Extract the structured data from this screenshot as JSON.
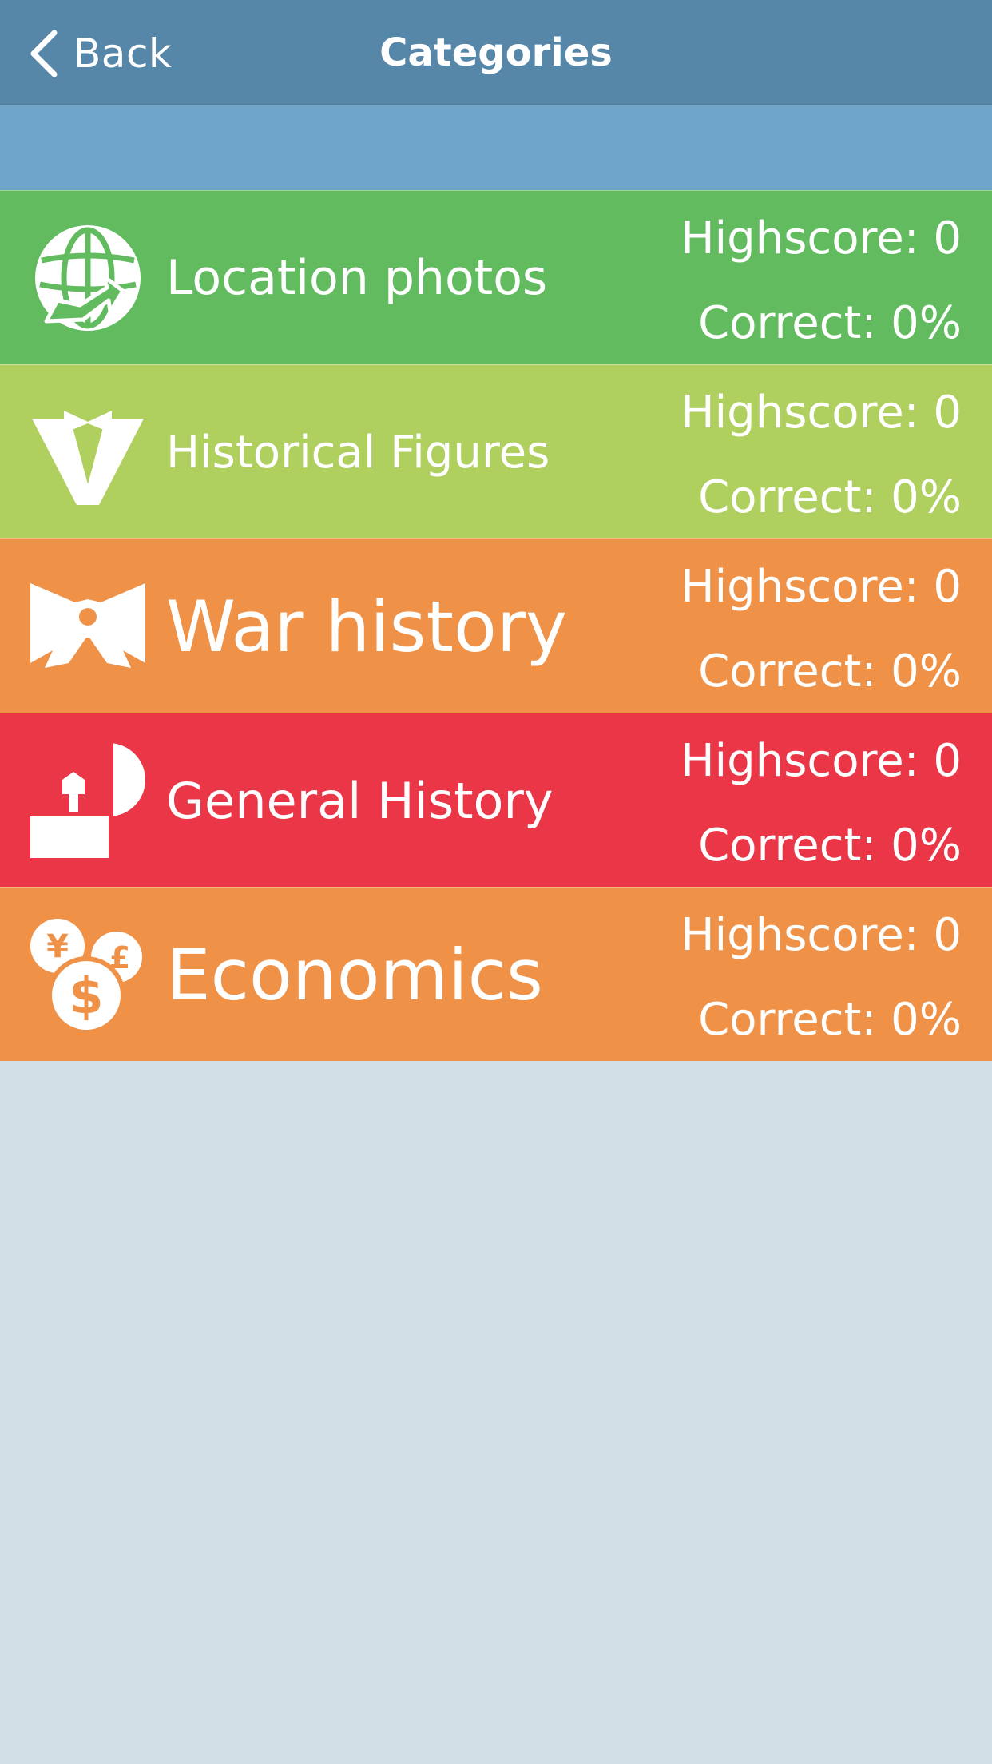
{
  "navbar": {
    "back_label": "Back",
    "title": "Categories",
    "background": "#5686a8"
  },
  "subheader": {
    "background": "#6fa5c9"
  },
  "categories": [
    {
      "label": "Location photos",
      "icon": "globe-icon",
      "color": "#63bb60",
      "highscore": "Highscore: 0",
      "correct": "Correct: 0%"
    },
    {
      "label": "Historical Figures",
      "icon": "tuxedo-icon",
      "color": "#afcf5e",
      "highscore": "Highscore: 0",
      "correct": "Correct: 0%"
    },
    {
      "label": "War history",
      "icon": "bow-icon",
      "color": "#ef9248",
      "highscore": "Highscore: 0",
      "correct": "Correct: 0%"
    },
    {
      "label": "General History",
      "icon": "shapes-icon",
      "color": "#ea3646",
      "highscore": "Highscore: 0",
      "correct": "Correct: 0%"
    },
    {
      "label": "Economics",
      "icon": "coins-icon",
      "color": "#ef9248",
      "highscore": "Highscore: 0",
      "correct": "Correct: 0%"
    }
  ]
}
